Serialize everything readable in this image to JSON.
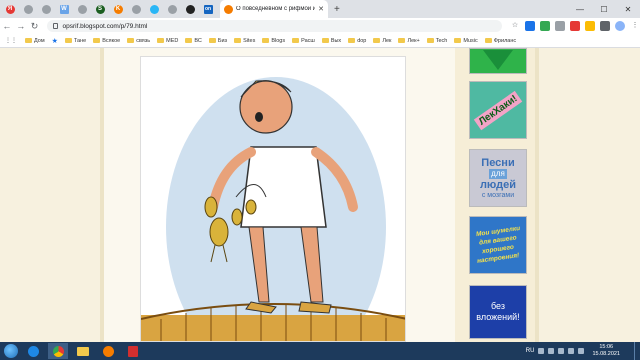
{
  "browser": {
    "tab_title": "О повседневном с рифмой и ...",
    "url": "opsrif.blogspot.com/p/79.html",
    "tabs_favicons": [
      "yandex-icon",
      "chrome-icon",
      "chrome-icon",
      "word-icon",
      "chrome-icon",
      "kinopoisk-icon",
      "chrome-icon",
      "chrome-icon",
      "chrome-icon",
      "chrome-icon",
      "chrome-icon"
    ]
  },
  "bookmarks": [
    {
      "label": "Дом",
      "kind": "star"
    },
    {
      "label": "Тане",
      "kind": "folder"
    },
    {
      "label": "Всякое",
      "kind": "folder"
    },
    {
      "label": "связь",
      "kind": "folder"
    },
    {
      "label": "MED",
      "kind": "folder"
    },
    {
      "label": "ВС",
      "kind": "folder"
    },
    {
      "label": "Биз",
      "kind": "folder"
    },
    {
      "label": "Sites",
      "kind": "folder"
    },
    {
      "label": "Blogs",
      "kind": "folder"
    },
    {
      "label": "Расш",
      "kind": "folder"
    },
    {
      "label": "Вых",
      "kind": "folder"
    },
    {
      "label": "dop",
      "kind": "folder"
    },
    {
      "label": "Лек",
      "kind": "folder"
    },
    {
      "label": "Лек+",
      "kind": "folder"
    },
    {
      "label": "Tech",
      "kind": "folder"
    },
    {
      "label": "Music",
      "kind": "folder"
    },
    {
      "label": "Фриланс",
      "kind": "folder"
    }
  ],
  "sidebar": {
    "banner_2": "ЛекХаки!",
    "banner_3": {
      "line1": "Песни",
      "line2": "для",
      "line3": "людей",
      "line4": "с мозгами"
    },
    "banner_4": {
      "line1": "Мои шумелки",
      "line2": "для вашего",
      "line3": "хорошего",
      "line4": "настроения!"
    },
    "banner_5": {
      "line1": "без",
      "line2": "вложений!"
    }
  },
  "taskbar": {
    "language": "RU",
    "time": "15:06",
    "date": "15.08.2021"
  },
  "colors": {
    "page_bg": "#f7f1df",
    "taskbar_bg": "#1d3a5c",
    "tab_strip": "#dee1e6"
  }
}
